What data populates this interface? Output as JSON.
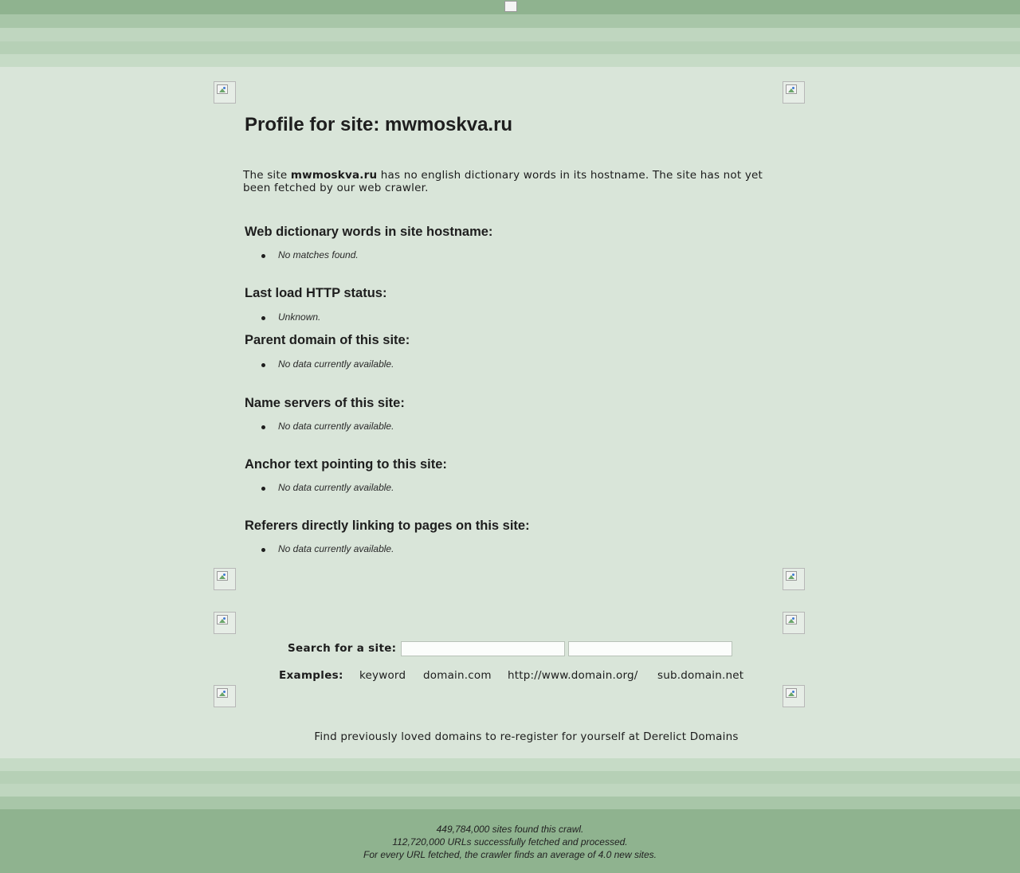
{
  "page": {
    "title": "Profile for site: mwmoskva.ru"
  },
  "intro": {
    "prefix": "The site ",
    "site": "mwmoskva.ru",
    "suffix": " has no english dictionary words in its hostname. The site has not yet been fetched by our web crawler."
  },
  "sections": [
    {
      "heading": "Web dictionary words in site hostname:",
      "item": "No matches found."
    },
    {
      "heading": "Last load HTTP status:",
      "item": "Unknown."
    },
    {
      "heading": "Parent domain of this site:",
      "item": "No data currently available."
    },
    {
      "heading": "Name servers of this site:",
      "item": "No data currently available."
    },
    {
      "heading": "Anchor text pointing to this site:",
      "item": "No data currently available."
    },
    {
      "heading": "Referers directly linking to pages on this site:",
      "item": "No data currently available."
    }
  ],
  "search": {
    "label": "Search for a site:",
    "input1_value": "",
    "input2_value": ""
  },
  "examples": {
    "label": "Examples:",
    "items": [
      "keyword",
      "domain.com",
      "http://www.domain.org/",
      "sub.domain.net"
    ]
  },
  "derelict": "Find previously loved domains to re-register for yourself at Derelict Domains",
  "footer": {
    "line1": "449,784,000 sites found this crawl.",
    "line2": "112,720,000 URLs successfully fetched and processed.",
    "line3": "For every URL fetched, the crawler finds an average of 4.0 new sites."
  },
  "colors": {
    "background": "#d9e5d9",
    "band_dark": "#8fb38f",
    "band_light": "#bfd6bf"
  },
  "icons": {
    "placeholder": "broken-image-icon"
  }
}
